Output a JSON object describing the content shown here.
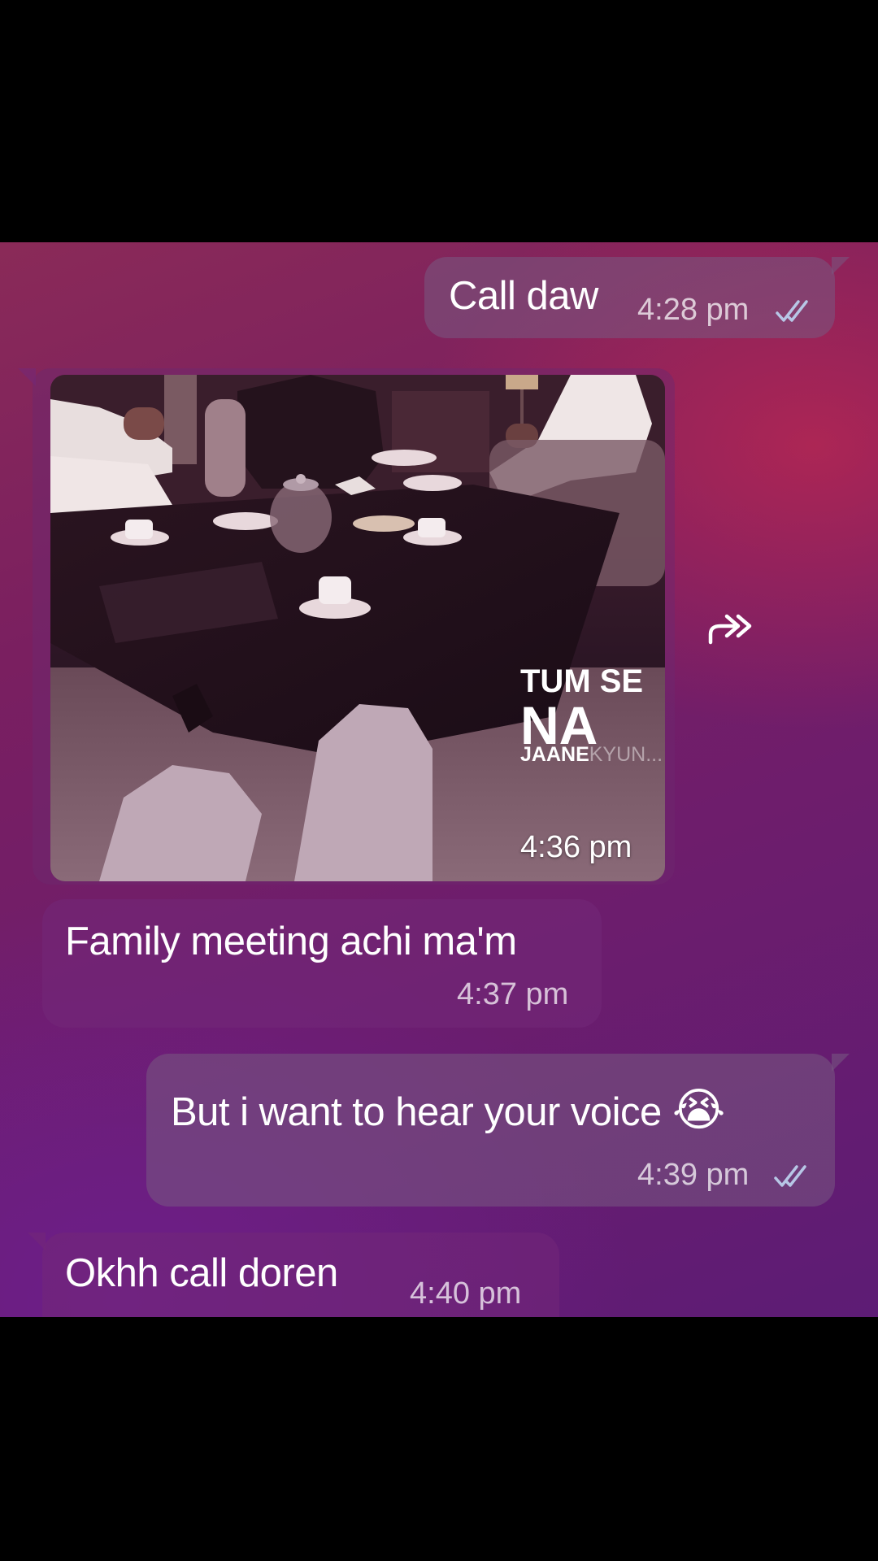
{
  "messages": [
    {
      "id": "m1",
      "direction": "outgoing",
      "text": "Call daw",
      "time": "4:28 pm",
      "status": "read"
    },
    {
      "id": "m2",
      "direction": "incoming",
      "type": "photo",
      "time": "4:36 pm",
      "overlay": {
        "line1": "TUM SE",
        "line2": "NA",
        "line3": "JAANE",
        "line3_faded": "KYUN..."
      }
    },
    {
      "id": "m3",
      "direction": "incoming",
      "text": "Family meeting achi ma'm",
      "time": "4:37 pm"
    },
    {
      "id": "m4",
      "direction": "outgoing",
      "text": "But i want to hear your voice",
      "emoji": "😭",
      "time": "4:39 pm",
      "status": "read"
    },
    {
      "id": "m5",
      "direction": "incoming",
      "text": "Okhh call doren",
      "time": "4:40 pm"
    }
  ],
  "icons": {
    "forward": "forward-icon",
    "read_receipt": "double-check-icon"
  },
  "colors": {
    "tick": "#b7c7e6",
    "text": "#ffffff"
  }
}
